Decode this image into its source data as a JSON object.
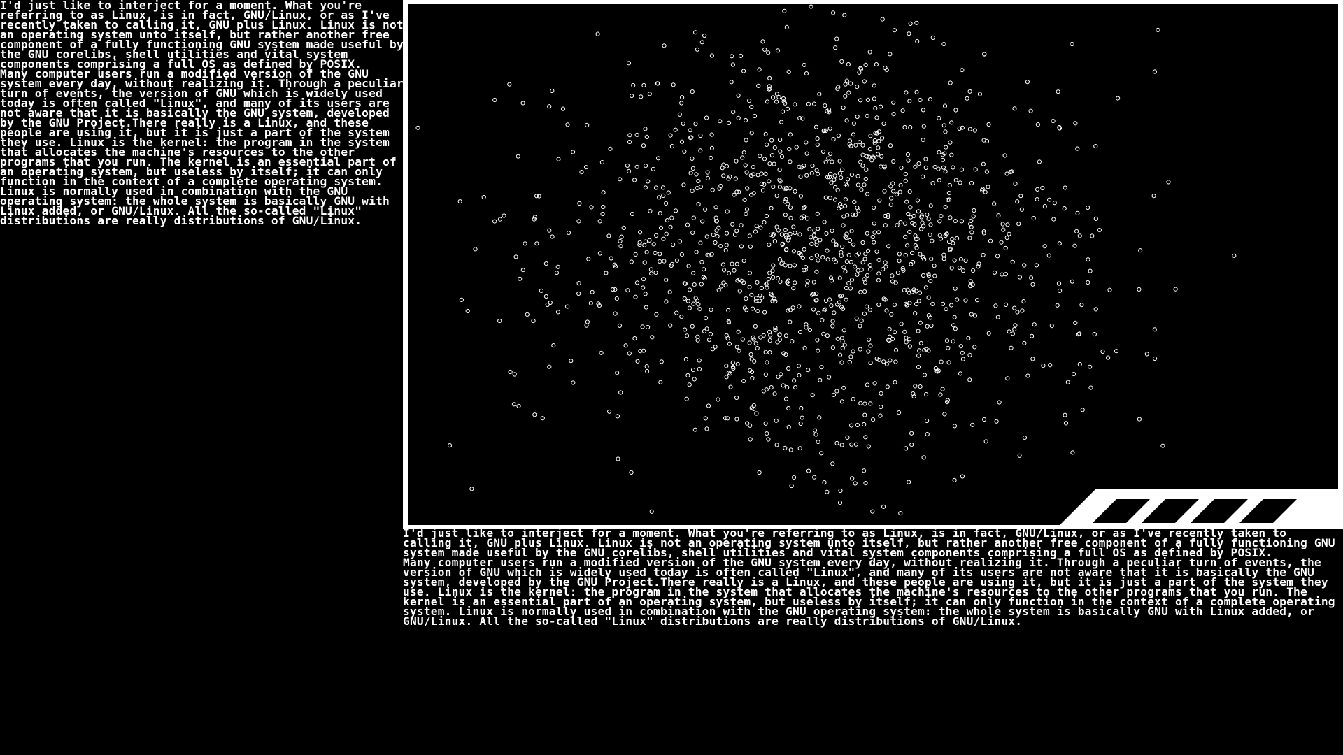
{
  "left_panel": {
    "paragraph_1": "I'd just like to interject for a moment. What you're referring to as Linux, is in fact, GNU/Linux, or as I've recently taken to calling it, GNU plus Linux. Linux is not an operating system unto itself, but rather another free component of a fully functioning GNU system made useful by the GNU corelibs, shell utilities and vital system components comprising a full OS as defined by POSIX.",
    "paragraph_2": "Many computer users run a modified version of the GNU system every day, without realizing it. Through a peculiar turn of events, the version of GNU which is widely used today is often called \"Linux\", and many of its users are not aware that it is basically the GNU system, developed by the GNU Project.There really is a Linux, and these people are using it, but it is just a part of the system they use. Linux is the kernel: the program in the system that allocates the machine's resources to the other programs that you run. The kernel is an essential part of an operating system, but useless by itself; it can only function in the context of a complete operating system. Linux is normally used in combination with the GNU operating system: the whole system is basically GNU with Linux added, or GNU/Linux. All the so-called \"Linux\" distributions are really distributions of GNU/Linux."
  },
  "bottom_panel": {
    "paragraph_1": "I'd just like to interject for a moment. What you're referring to as Linux, is in fact, GNU/Linux, or as I've recently taken to calling it, GNU plus Linux. Linux is not an operating system unto itself, but rather another free component of a fully functioning GNU system made useful by the GNU corelibs, shell utilities and vital system components comprising a full OS as defined by POSIX.",
    "paragraph_2": "Many computer users run a modified version of the GNU system every day, without realizing it. Through a peculiar turn of events, the version of GNU which is widely used today is often called \"Linux\", and many of its users are not aware that it is basically the GNU system, developed by the GNU Project.There really is a Linux, and these people are using it, but it is just a part of the system they use. Linux is the kernel: the program in the system that allocates the machine's resources to the other programs that you run. The kernel is an essential part of an operating system, but useless by itself; it can only function in the context of a complete operating system. Linux is normally used in combination with the GNU operating system: the whole system is basically GNU with Linux added, or GNU/Linux. All the so-called \"Linux\" distributions are really distributions of GNU/Linux."
  },
  "particle_view": {
    "background_color": "#000000",
    "particle_color": "#ffffff",
    "frame_color": "#ffffff",
    "particle_count": 1400
  },
  "stripe_banner": {
    "color": "#ffffff",
    "stripe_count": 4
  }
}
